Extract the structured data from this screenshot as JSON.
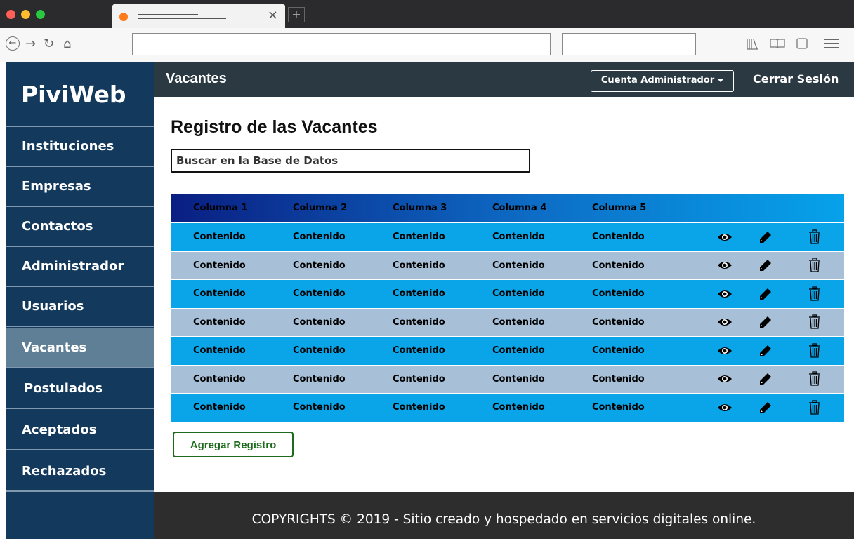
{
  "brand": "PiviWeb",
  "sidebar": {
    "items": [
      {
        "label": "Instituciones"
      },
      {
        "label": "Empresas"
      },
      {
        "label": "Contactos"
      },
      {
        "label": "Administrador"
      },
      {
        "label": "Usuarios"
      },
      {
        "label": "Vacantes",
        "active": true
      },
      {
        "label": "Postulados"
      },
      {
        "label": "Aceptados"
      },
      {
        "label": "Rechazados"
      }
    ]
  },
  "header": {
    "title": "Vacantes",
    "account_label": "Cuenta Administrador",
    "logout_label": "Cerrar Sesión"
  },
  "main": {
    "title": "Registro de las Vacantes",
    "search_placeholder": "Buscar en la Base de Datos",
    "add_button_label": "Agregar Registro"
  },
  "table": {
    "columns": [
      "Columna 1",
      "Columna 2",
      "Columna 3",
      "Columna 4",
      "Columna 5"
    ],
    "rows": [
      [
        "Contenido",
        "Contenido",
        "Contenido",
        "Contenido",
        "Contenido"
      ],
      [
        "Contenido",
        "Contenido",
        "Contenido",
        "Contenido",
        "Contenido"
      ],
      [
        "Contenido",
        "Contenido",
        "Contenido",
        "Contenido",
        "Contenido"
      ],
      [
        "Contenido",
        "Contenido",
        "Contenido",
        "Contenido",
        "Contenido"
      ],
      [
        "Contenido",
        "Contenido",
        "Contenido",
        "Contenido",
        "Contenido"
      ],
      [
        "Contenido",
        "Contenido",
        "Contenido",
        "Contenido",
        "Contenido"
      ],
      [
        "Contenido",
        "Contenido",
        "Contenido",
        "Contenido",
        "Contenido"
      ]
    ],
    "row_actions": [
      "eye-icon",
      "pencil-icon",
      "trash-icon"
    ]
  },
  "footer": {
    "text": "COPYRIGHTS © 2019 - Sitio creado y hospedado en servicios digitales online."
  },
  "colors": {
    "sidebar_bg": "#133a5c",
    "sidebar_active": "#5f7f96",
    "topbar_bg": "#2b3942",
    "row_blue": "#0aa5e8",
    "row_grey": "#a7c0d8",
    "add_button": "#1e6b1e",
    "footer_bg": "#2d2d2d"
  }
}
